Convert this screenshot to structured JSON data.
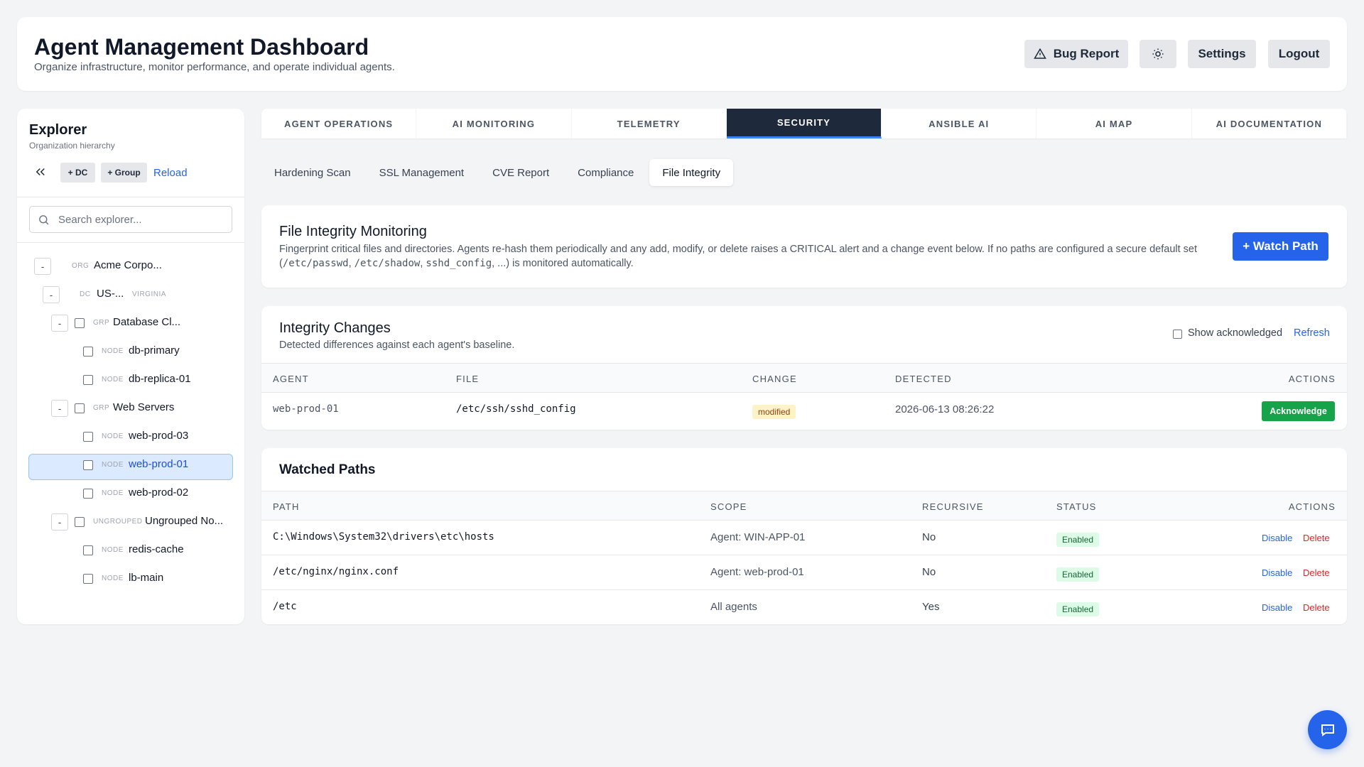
{
  "header": {
    "title": "Agent Management Dashboard",
    "subtitle": "Organize infrastructure, monitor performance, and operate individual agents.",
    "bug_report": "Bug Report",
    "settings": "Settings",
    "logout": "Logout"
  },
  "sidebar": {
    "title": "Explorer",
    "subtitle": "Organization hierarchy",
    "add_dc": "+ DC",
    "add_group": "+ Group",
    "reload": "Reload",
    "search_placeholder": "Search explorer...",
    "tree": [
      {
        "toggle": "-",
        "kind": "ORG",
        "name": "Acme Corpo..."
      },
      {
        "toggle": "-",
        "kind": "DC",
        "name": "US-...",
        "region": "VIRGINIA"
      },
      {
        "toggle": "-",
        "kind": "GRP",
        "name": "Database Cl..."
      },
      {
        "kind": "NODE",
        "name": "db-primary"
      },
      {
        "kind": "NODE",
        "name": "db-replica-01"
      },
      {
        "toggle": "-",
        "kind": "GRP",
        "name": "Web Servers"
      },
      {
        "kind": "NODE",
        "name": "web-prod-03"
      },
      {
        "kind": "NODE",
        "name": "web-prod-01",
        "selected": true
      },
      {
        "kind": "NODE",
        "name": "web-prod-02"
      },
      {
        "toggle": "-",
        "kind": "UNGROUPED",
        "name": "Ungrouped No..."
      },
      {
        "kind": "NODE",
        "name": "redis-cache"
      },
      {
        "kind": "NODE",
        "name": "lb-main"
      }
    ]
  },
  "tabs": [
    "AGENT OPERATIONS",
    "AI MONITORING",
    "TELEMETRY",
    "SECURITY",
    "ANSIBLE AI",
    "AI MAP",
    "AI DOCUMENTATION"
  ],
  "active_tab": "SECURITY",
  "subtabs": [
    "Hardening Scan",
    "SSL Management",
    "CVE Report",
    "Compliance",
    "File Integrity"
  ],
  "active_subtab": "File Integrity",
  "fim": {
    "title": "File Integrity Monitoring",
    "desc_1": "Fingerprint critical files and directories. Agents re-hash them periodically and any add, modify, or delete raises a CRITICAL alert and a change event below. If no paths are configured a secure default set",
    "desc_open": "(",
    "desc_code_1": "/etc/passwd",
    "desc_comma_1": ", ",
    "desc_code_2": "/etc/shadow",
    "desc_comma_2": ", ",
    "desc_code_3": "sshd_config",
    "desc_tail": ", ...) is monitored automatically.",
    "watch_button": "+ Watch Path"
  },
  "changes": {
    "title": "Integrity Changes",
    "subtitle": "Detected differences against each agent's baseline.",
    "show_ack": "Show acknowledged",
    "refresh": "Refresh",
    "columns": [
      "AGENT",
      "FILE",
      "CHANGE",
      "DETECTED",
      "ACTIONS"
    ],
    "rows": [
      {
        "agent": "web-prod-01",
        "file": "/etc/ssh/sshd_config",
        "change": "modified",
        "detected": "2026-06-13 08:26:22",
        "action": "Acknowledge"
      }
    ]
  },
  "watched": {
    "title": "Watched Paths",
    "columns": [
      "PATH",
      "SCOPE",
      "RECURSIVE",
      "STATUS",
      "ACTIONS"
    ],
    "rows": [
      {
        "path": "C:\\Windows\\System32\\drivers\\etc\\hosts",
        "scope": "Agent: WIN-APP-01",
        "recursive": "No",
        "status": "Enabled",
        "disable": "Disable",
        "delete": "Delete"
      },
      {
        "path": "/etc/nginx/nginx.conf",
        "scope": "Agent: web-prod-01",
        "recursive": "No",
        "status": "Enabled",
        "disable": "Disable",
        "delete": "Delete"
      },
      {
        "path": "/etc",
        "scope": "All agents",
        "recursive": "Yes",
        "status": "Enabled",
        "disable": "Disable",
        "delete": "Delete"
      }
    ]
  },
  "icons": [
    "warning-icon",
    "sun-icon",
    "chevrons-left-icon",
    "search-icon",
    "chat-icon"
  ],
  "colors": {
    "accent": "#2563eb",
    "active_tab": "#1e293b",
    "success": "#16a34a",
    "danger": "#dc2626"
  }
}
